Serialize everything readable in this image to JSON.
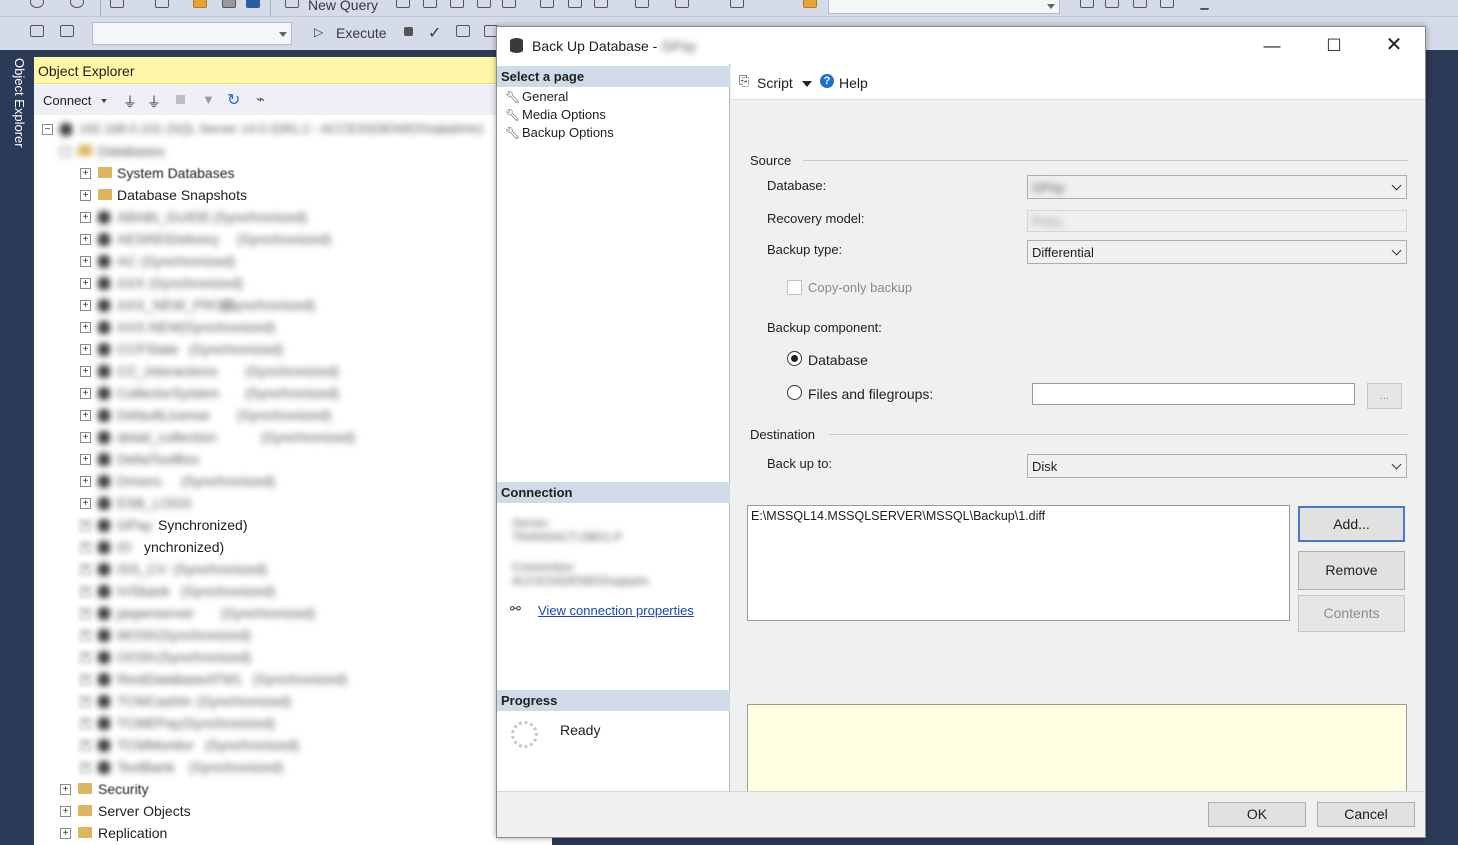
{
  "toolbar": {
    "new_query_label": "New Query",
    "execute_label": "Execute"
  },
  "side_tab": {
    "label": "Object Explorer"
  },
  "object_explorer": {
    "title": "Object Explorer",
    "connect_label": "Connect",
    "tree": {
      "server_label": "192.168.0.101 (SQL Server 14.0.3281.2 - ACCESSDENIED\\sqladmin)",
      "databases_label": "Databases",
      "system_databases_label": "System Databases",
      "snapshots_label": "Database Snapshots",
      "databases": [
        {
          "name": "ABABI_GUIDE",
          "state": "(Synchronized)"
        },
        {
          "name": "AESREIDelivery",
          "state": "(Synchronized)"
        },
        {
          "name": "AC",
          "state": "(Synchronized)"
        },
        {
          "name": "AXX",
          "state": "(Synchronized)"
        },
        {
          "name": "AXX_NEW_PROD",
          "state": "(Synchronized)"
        },
        {
          "name": "AXX.NEW",
          "state": "(Synchronized)"
        },
        {
          "name": "CCFState",
          "state": "(Synchronized)"
        },
        {
          "name": "CC_Interactions",
          "state": "(Synchronized)"
        },
        {
          "name": "CollectorSystem",
          "state": "(Synchronized)"
        },
        {
          "name": "DefaultLicense",
          "state": "(Synchronized)"
        },
        {
          "name": "detail_collection",
          "state": "(Synchronized)"
        },
        {
          "name": "DeltaToolBox",
          "state": ""
        },
        {
          "name": "Drivers",
          "state": "(Synchronized)"
        },
        {
          "name": "ESB_LOGS",
          "state": ""
        },
        {
          "name": "GPay",
          "state": "Synchronized)"
        },
        {
          "name": "IO",
          "state": "ynchronized)"
        },
        {
          "name": "ISS_CV",
          "state": "(Synchronized)"
        },
        {
          "name": "IVSbank",
          "state": "(Synchronized)"
        },
        {
          "name": "jasperserver",
          "state": "(Synchronized)"
        },
        {
          "name": "MOSh",
          "state": "(Synchronized)"
        },
        {
          "name": "OOSh",
          "state": "(Synchronized)"
        },
        {
          "name": "RestDatabaseATM1",
          "state": "(Synchronized)"
        },
        {
          "name": "TCMCashIn",
          "state": "(Synchronized)"
        },
        {
          "name": "TCMEPay",
          "state": "(Synchronized)"
        },
        {
          "name": "TCMMonitor",
          "state": "(Synchronized)"
        },
        {
          "name": "TextBank",
          "state": "(Synchronized)"
        }
      ],
      "bottom_folders": [
        "Security",
        "Server Objects",
        "Replication"
      ]
    }
  },
  "dialog": {
    "title": "Back Up Database",
    "title_db": "GPay",
    "select_page_header": "Select a page",
    "pages": [
      "General",
      "Media Options",
      "Backup Options"
    ],
    "connection_header": "Connection",
    "connection": {
      "server_label": "Server:",
      "server_value": "TRANSACT-DB01-P",
      "connection_label": "Connection:",
      "connection_value": "ACCESSDENIED\\sqladm",
      "view_link": "View connection properties"
    },
    "progress_header": "Progress",
    "progress_status": "Ready",
    "script_label": "Script",
    "help_label": "Help",
    "source_group": "Source",
    "database_label": "Database:",
    "database_value": "GPay",
    "recovery_label": "Recovery model:",
    "recovery_value": "FULL",
    "backup_type_label": "Backup type:",
    "backup_type_value": "Differential",
    "copy_only_label": "Copy-only backup",
    "backup_component_label": "Backup component:",
    "component_database_label": "Database",
    "component_files_label": "Files and filegroups:",
    "files_button": "...",
    "destination_group": "Destination",
    "backup_to_label": "Back up to:",
    "backup_to_value": "Disk",
    "destination_path": "E:\\MSSQL14.MSSQLSERVER\\MSSQL\\Backup\\1.diff",
    "add_button": "Add...",
    "remove_button": "Remove",
    "contents_button": "Contents",
    "ok_button": "OK",
    "cancel_button": "Cancel",
    "colors": {
      "message_area_bg": "#ffffe1",
      "section_header_bg": "#cfdbe9",
      "focus_border": "#4a79c6"
    }
  }
}
